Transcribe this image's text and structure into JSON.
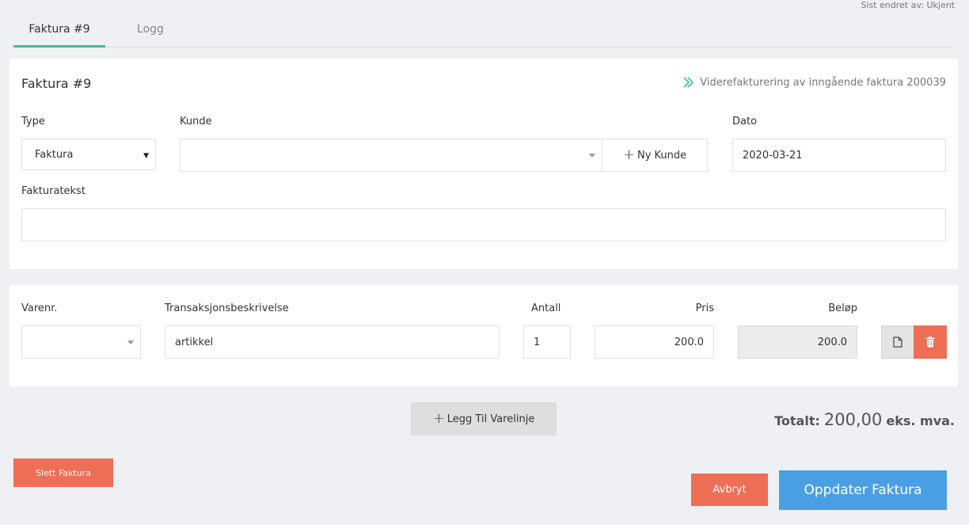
{
  "header": {
    "last_edited": "Sist endret av: Ukjent"
  },
  "tabs": [
    {
      "label": "Faktura #9"
    },
    {
      "label": "Logg"
    }
  ],
  "invoice": {
    "title": "Faktura #9",
    "rebilling_text": "Viderefakturering av inngående faktura 200039",
    "type_label": "Type",
    "type_value": "Faktura",
    "customer_label": "Kunde",
    "customer_value": "",
    "new_customer_label": "Ny Kunde",
    "date_label": "Dato",
    "date_value": "2020-03-21",
    "invoice_text_label": "Fakturatekst",
    "invoice_text_value": ""
  },
  "lines": {
    "headers": {
      "item_no": "Varenr.",
      "description": "Transaksjonsbeskrivelse",
      "quantity": "Antall",
      "price": "Pris",
      "amount": "Beløp"
    },
    "rows": [
      {
        "item_no": "",
        "description": "artikkel",
        "quantity": "1",
        "price": "200.0",
        "amount": "200.0"
      }
    ]
  },
  "actions": {
    "add_line_label": "Legg Til Varelinje",
    "delete_invoice_label": "Slett Faktura",
    "cancel_label": "Avbryt",
    "update_label": "Oppdater Faktura"
  },
  "totals": {
    "prefix": "Totalt:",
    "amount": "200,00",
    "suffix": "eks. mva."
  },
  "colors": {
    "accent_green": "#3ec28f",
    "danger": "#ef6e56",
    "primary": "#4a9fe4"
  },
  "icons": [
    "double-chevron-right-icon",
    "plus-icon",
    "caret-down-icon",
    "document-icon",
    "trash-icon"
  ]
}
